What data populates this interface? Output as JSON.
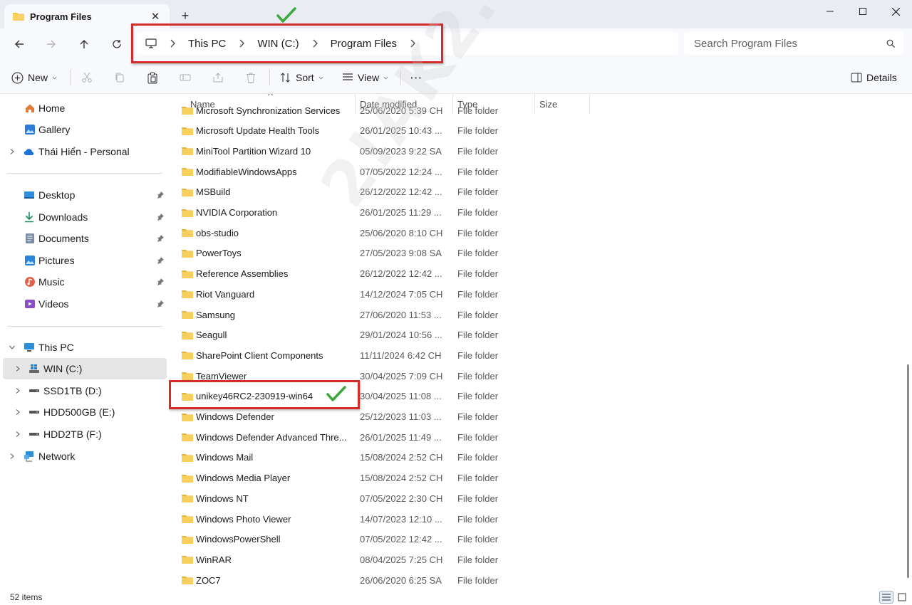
{
  "tab": {
    "title": "Program Files",
    "close": "✕",
    "new": "+"
  },
  "address": {
    "crumbs": [
      "This PC",
      "WIN (C:)",
      "Program Files"
    ]
  },
  "search": {
    "placeholder": "Search Program Files"
  },
  "toolbar": {
    "new_label": "New",
    "sort_label": "Sort",
    "view_label": "View",
    "more_label": "···",
    "details_label": "Details"
  },
  "sidebar": {
    "top": [
      "Home",
      "Gallery",
      "Thái Hiển - Personal"
    ],
    "quick": [
      "Desktop",
      "Downloads",
      "Documents",
      "Pictures",
      "Music",
      "Videos"
    ],
    "drives": {
      "this_pc": "This PC",
      "win": "WIN (C:)",
      "ssd": "SSD1TB (D:)",
      "hdd500": "HDD500GB (E:)",
      "hdd2": "HDD2TB (F:)",
      "network": "Network"
    }
  },
  "columns": {
    "name": "Name",
    "date": "Date modified",
    "type": "Type",
    "size": "Size"
  },
  "files": [
    {
      "name": "Microsoft Synchronization Services",
      "date": "25/06/2020 5:39 CH",
      "type": "File folder"
    },
    {
      "name": "Microsoft Update Health Tools",
      "date": "26/01/2025 10:43 ...",
      "type": "File folder"
    },
    {
      "name": "MiniTool Partition Wizard 10",
      "date": "05/09/2023 9:22 SA",
      "type": "File folder"
    },
    {
      "name": "ModifiableWindowsApps",
      "date": "07/05/2022 12:24 ...",
      "type": "File folder"
    },
    {
      "name": "MSBuild",
      "date": "26/12/2022 12:42 ...",
      "type": "File folder"
    },
    {
      "name": "NVIDIA Corporation",
      "date": "26/01/2025 11:29 ...",
      "type": "File folder"
    },
    {
      "name": "obs-studio",
      "date": "25/06/2020 8:10 CH",
      "type": "File folder"
    },
    {
      "name": "PowerToys",
      "date": "27/05/2023 9:08 SA",
      "type": "File folder"
    },
    {
      "name": "Reference Assemblies",
      "date": "26/12/2022 12:42 ...",
      "type": "File folder"
    },
    {
      "name": "Riot Vanguard",
      "date": "14/12/2024 7:05 CH",
      "type": "File folder"
    },
    {
      "name": "Samsung",
      "date": "27/06/2020 11:53 ...",
      "type": "File folder"
    },
    {
      "name": "Seagull",
      "date": "29/01/2024 10:56 ...",
      "type": "File folder"
    },
    {
      "name": "SharePoint Client Components",
      "date": "11/11/2024 6:42 CH",
      "type": "File folder"
    },
    {
      "name": "TeamViewer",
      "date": "30/04/2025 7:09 CH",
      "type": "File folder"
    },
    {
      "name": "unikey46RC2-230919-win64",
      "date": "30/04/2025 11:08 ...",
      "type": "File folder"
    },
    {
      "name": "Windows Defender",
      "date": "25/12/2023 11:03 ...",
      "type": "File folder"
    },
    {
      "name": "Windows Defender Advanced Thre...",
      "date": "26/01/2025 11:49 ...",
      "type": "File folder"
    },
    {
      "name": "Windows Mail",
      "date": "15/08/2024 2:52 CH",
      "type": "File folder"
    },
    {
      "name": "Windows Media Player",
      "date": "15/08/2024 2:52 CH",
      "type": "File folder"
    },
    {
      "name": "Windows NT",
      "date": "07/05/2022 2:30 CH",
      "type": "File folder"
    },
    {
      "name": "Windows Photo Viewer",
      "date": "14/07/2023 12:10 ...",
      "type": "File folder"
    },
    {
      "name": "WindowsPowerShell",
      "date": "07/05/2022 12:42 ...",
      "type": "File folder"
    },
    {
      "name": "WinRAR",
      "date": "08/04/2025 7:25 CH",
      "type": "File folder"
    },
    {
      "name": "ZOC7",
      "date": "26/06/2020 6:25 SA",
      "type": "File folder"
    }
  ],
  "status": {
    "count": "52 items"
  },
  "watermark": "2!AK2.COM",
  "colors": {
    "highlight": "#d52b2b",
    "folder": "#f2c94c",
    "check": "#3aa83a"
  }
}
